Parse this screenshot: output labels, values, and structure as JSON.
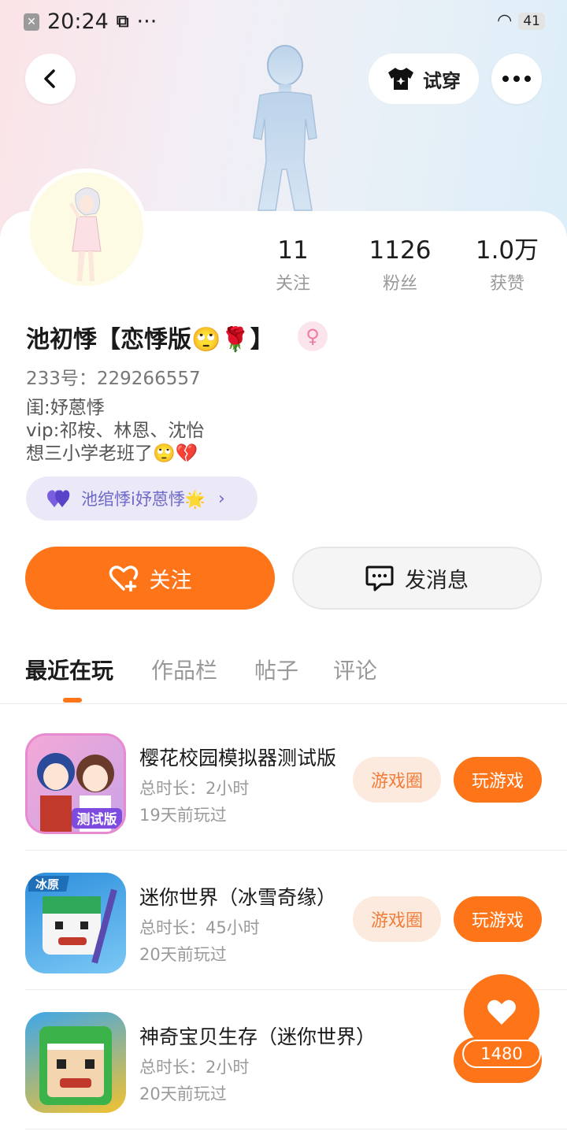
{
  "status_bar": {
    "time": "20:24",
    "dots": "···",
    "battery": "41"
  },
  "header": {
    "tryon_label": "试穿"
  },
  "profile": {
    "name": "池初悸【恋悸版🙄🌹】",
    "gender_symbol": "♀",
    "uid": "233号：229266557",
    "bio_lines": [
      "闺:妤蒽悸",
      "vip:祁桉、林恩、沈怡",
      "想三小学老班了🙄💔"
    ],
    "tag_label": "池绾悸i妤蒽悸🌟",
    "stats": [
      {
        "value": "11",
        "label": "关注"
      },
      {
        "value": "1126",
        "label": "粉丝"
      },
      {
        "value": "1.0万",
        "label": "获赞"
      }
    ]
  },
  "actions": {
    "follow_label": "关注",
    "message_label": "发消息"
  },
  "tabs": [
    {
      "label": "最近在玩",
      "active": true
    },
    {
      "label": "作品栏",
      "active": false
    },
    {
      "label": "帖子",
      "active": false
    },
    {
      "label": "评论",
      "active": false
    }
  ],
  "games": [
    {
      "title": "樱花校园模拟器测试版",
      "duration": "总时长：2小时",
      "last_played": "19天前玩过",
      "circle_label": "游戏圈",
      "play_label": "玩游戏",
      "badge": "测试版"
    },
    {
      "title": "迷你世界（冰雪奇缘）",
      "duration": "总时长：45小时",
      "last_played": "20天前玩过",
      "circle_label": "游戏圈",
      "play_label": "玩游戏",
      "badge": "冰原"
    },
    {
      "title": "神奇宝贝生存（迷你世界）",
      "duration": "总时长：2小时",
      "last_played": "20天前玩过",
      "circle_label": "",
      "play_label": "",
      "badge": ""
    }
  ],
  "like_widget": {
    "count": "1480"
  },
  "colors": {
    "accent": "#fd7518",
    "chip_bg": "#fdeadf",
    "tag_bg": "#ebe9f8"
  }
}
